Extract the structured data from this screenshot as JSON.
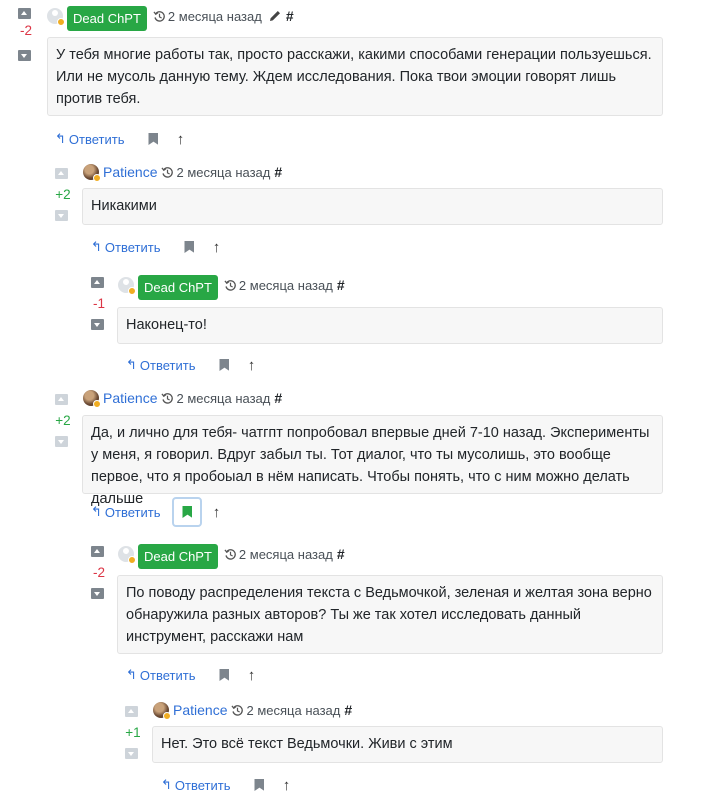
{
  "comments": [
    {
      "author": "Dead ChPT",
      "author_type": "badge",
      "date": "2 месяца назад",
      "hash": "#",
      "edited": true,
      "score": "-2",
      "score_sign": "neg",
      "text": "У тебя многие работы так, просто расскажи, какими способами генерации пользуешься. Или не мусоль данную тему. Ждем исследования. Пока твои эмоции говорят лишь против тебя.",
      "reply_label": "Ответить",
      "bookmarked": false
    },
    {
      "author": "Patience",
      "author_type": "link",
      "date": "2 месяца назад",
      "hash": "#",
      "edited": false,
      "score": "+2",
      "score_sign": "pos",
      "text": "Никакими",
      "reply_label": "Ответить",
      "bookmarked": false
    },
    {
      "author": "Dead ChPT",
      "author_type": "badge",
      "date": "2 месяца назад",
      "hash": "#",
      "edited": false,
      "score": "-1",
      "score_sign": "neg",
      "text": "Наконец-то!",
      "reply_label": "Ответить",
      "bookmarked": false
    },
    {
      "author": "Patience",
      "author_type": "link",
      "date": "2 месяца назад",
      "hash": "#",
      "edited": false,
      "score": "+2",
      "score_sign": "pos",
      "text": "Да, и лично для тебя- чатгпт попробовал впервые дней 7-10 назад. Эксперименты у меня, я говорил. Вдруг забыл ты. Тот диалог, что ты мусолишь, это вообще первое, что я пробоыал в нём написать. Чтобы понять, что с ним можно делать дальше",
      "reply_label": "Ответить",
      "bookmarked": true
    },
    {
      "author": "Dead ChPT",
      "author_type": "badge",
      "date": "2 месяца назад",
      "hash": "#",
      "edited": false,
      "score": "-2",
      "score_sign": "neg",
      "text": "По поводу распределения текста с Ведьмочкой, зеленая и желтая зона верно обнаружила разных авторов? Ты же так хотел исследовать данный инструмент, расскажи нам",
      "reply_label": "Ответить",
      "bookmarked": false
    },
    {
      "author": "Patience",
      "author_type": "link",
      "date": "2 месяца назад",
      "hash": "#",
      "edited": false,
      "score": "+1",
      "score_sign": "pos",
      "text": "Нет. Это всё текст Ведьмочки. Живи с этим",
      "reply_label": "Ответить",
      "bookmarked": false
    }
  ],
  "colors": {
    "badge_green": "#28a745",
    "link_blue": "#2f6fd6",
    "negative_red": "#dc3545",
    "positive_green": "#28a745"
  },
  "icons": {
    "clock": "history-clock-icon",
    "pencil": "pencil-icon",
    "bookmark": "bookmark-icon",
    "up": "up-arrow-icon",
    "reply": "reply-arrow-icon"
  }
}
